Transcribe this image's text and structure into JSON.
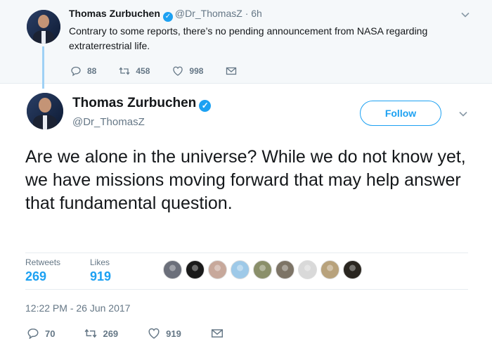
{
  "parent_tweet": {
    "name": "Thomas Zurbuchen",
    "handle": "@Dr_ThomasZ",
    "time": "· 6h",
    "text": "Contrary to some reports, there’s no pending announcement from NASA regarding extraterrestrial life.",
    "replies": "88",
    "retweets": "458",
    "likes": "998"
  },
  "main_tweet": {
    "name": "Thomas Zurbuchen",
    "handle": "@Dr_ThomasZ",
    "follow_label": "Follow",
    "text": "Are we alone in the universe? While we do not know yet, we have missions moving forward that may help answer that fundamental question.",
    "stats": {
      "retweets_label": "Retweets",
      "retweets_value": "269",
      "likes_label": "Likes",
      "likes_value": "919"
    },
    "liker_colors": [
      "#6b6f7a",
      "#1a1a1a",
      "#c7a89b",
      "#9ec9e8",
      "#8a8f6a",
      "#7d7466",
      "#d9d9d9",
      "#b8a27c",
      "#2a2620"
    ],
    "timestamp": "12:22 PM - 26 Jun 2017",
    "actions": {
      "replies": "70",
      "retweets": "269",
      "likes": "919"
    }
  },
  "colors": {
    "accent": "#1da1f2",
    "muted": "#657786",
    "thread_line": "#9fd1f5"
  },
  "icons": [
    "verified-badge-icon",
    "chevron-down-icon",
    "reply-icon",
    "retweet-icon",
    "like-icon",
    "direct-message-icon"
  ]
}
